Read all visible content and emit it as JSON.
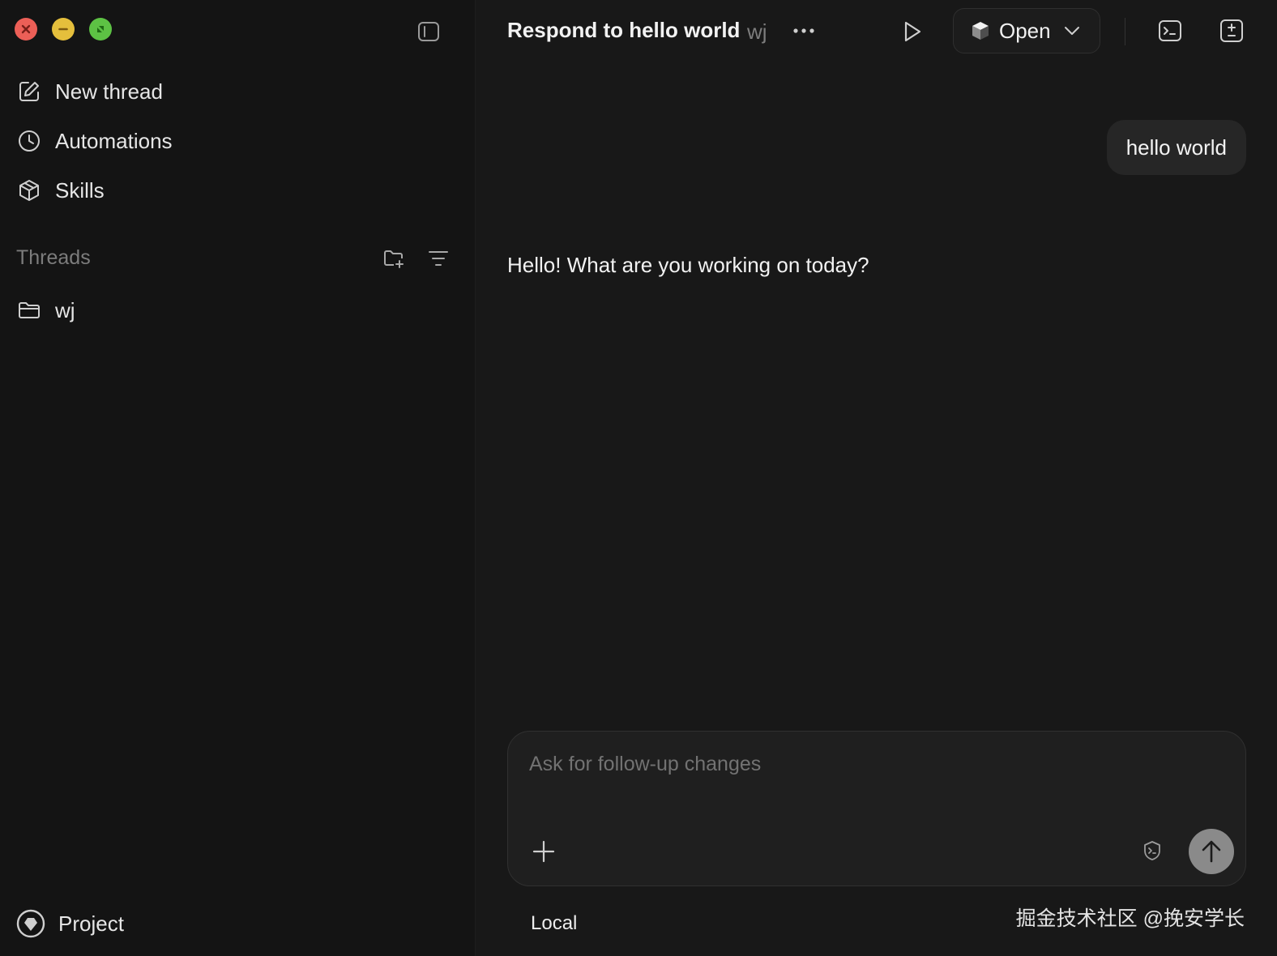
{
  "header": {
    "title": "Respond to hello world",
    "project": "wj",
    "open_label": "Open"
  },
  "sidebar": {
    "items": [
      {
        "label": "New thread",
        "icon": "edit-icon"
      },
      {
        "label": "Automations",
        "icon": "clock-icon"
      },
      {
        "label": "Skills",
        "icon": "cube-icon"
      }
    ],
    "threads_heading": "Threads",
    "folders": [
      {
        "label": "wj",
        "icon": "folder-icon"
      }
    ],
    "footer_label": "Project"
  },
  "chat": {
    "user_message": "hello world",
    "assistant_message": "Hello! What are you working on today?"
  },
  "composer": {
    "placeholder": "Ask for follow-up changes",
    "value": ""
  },
  "footer": {
    "environment": "Local",
    "watermark": "掘金技术社区 @挽安学长"
  },
  "colors": {
    "background": "#181818",
    "sidebar": "#141414",
    "traffic_close": "#ec5f57",
    "traffic_minimize": "#e5bf3c",
    "traffic_maximize": "#5dc244"
  }
}
